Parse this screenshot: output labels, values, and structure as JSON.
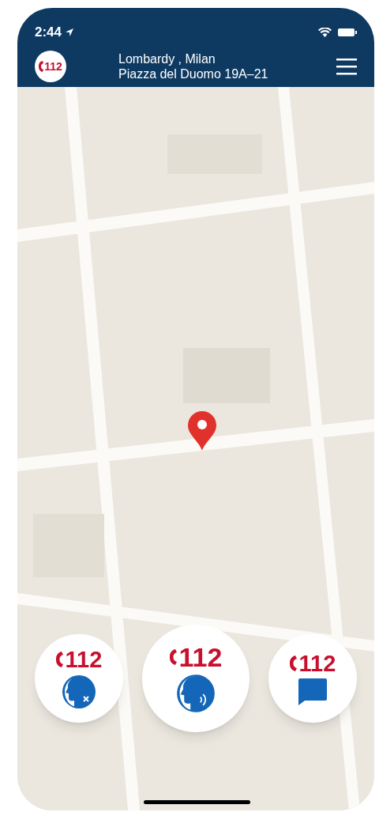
{
  "status_bar": {
    "time": "2:44"
  },
  "header": {
    "logo": "112",
    "region": "Lombardy , Milan",
    "address": "Piazza del Duomo 19A–21"
  },
  "call_buttons": [
    {
      "label": "112",
      "kind": "silent",
      "primary": false
    },
    {
      "label": "112",
      "kind": "voice",
      "primary": true
    },
    {
      "label": "112",
      "kind": "chat",
      "primary": false
    }
  ]
}
